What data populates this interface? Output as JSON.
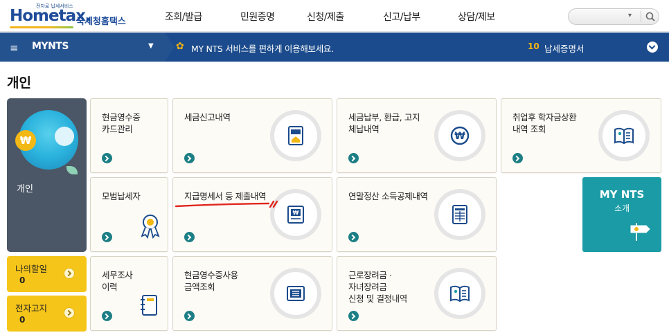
{
  "logo": {
    "tagline": "전자로 납세서비스",
    "brand": "Hometax.",
    "korean": "국세청홈택스"
  },
  "gnb": [
    "조회/발급",
    "민원증명",
    "신청/제출",
    "신고/납부",
    "상담/제보"
  ],
  "search": {
    "placeholder": ""
  },
  "navbar": {
    "brand": "MYNTS",
    "notice": "MY NTS 서비스를 편하게 이용해보세요.",
    "cert_count": "10",
    "cert_label": "납세증명서"
  },
  "page_title": "개인",
  "side": {
    "label": "개인"
  },
  "todo": {
    "label": "나의할일",
    "count": "0"
  },
  "ebill": {
    "label": "전자고지",
    "count": "0"
  },
  "cards": [
    {
      "title": "현금영수증\n카드관리",
      "icon": "none"
    },
    {
      "title": "세금신고내역",
      "icon": "tax-document-icon"
    },
    {
      "title": "세금납부, 환급, 고지\n체납내역",
      "icon": "won-coin-icon"
    },
    {
      "title": "취업후 학자금상환\n내역 조회",
      "icon": "open-book-icon"
    },
    {
      "title": "모범납세자",
      "icon": "award-ribbon-icon"
    },
    {
      "title": "지급명세서 등 제출내역",
      "icon": "won-statement-icon"
    },
    {
      "title": "연말정산 소득공제내역",
      "icon": "spreadsheet-icon"
    },
    {
      "title": "세무조사\n이력",
      "icon": "notebook-icon"
    },
    {
      "title": "현금영수증사용\n금액조회",
      "icon": "receipt-list-icon"
    },
    {
      "title": "근로장려금 ·\n자녀장려금\n신청 및 결정내역",
      "icon": "open-book-icon"
    }
  ],
  "mynts": {
    "title": "MY NTS",
    "subtitle": "소개"
  },
  "colors": {
    "navbar": "#1b4b8c",
    "teal": "#1a9ba5",
    "yellow": "#f6c51a",
    "arrow": "#1d7f86",
    "sidebar": "#4b5766"
  }
}
